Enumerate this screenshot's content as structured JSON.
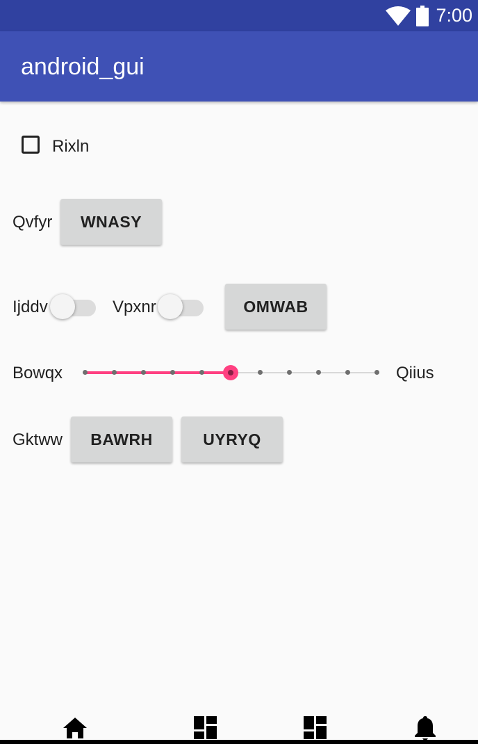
{
  "status_bar": {
    "time": "7:00",
    "wifi_icon": "wifi-icon",
    "battery_icon": "battery-icon"
  },
  "app_bar": {
    "title": "android_gui"
  },
  "checkbox": {
    "label": "Rixln",
    "checked": false
  },
  "row1": {
    "label": "Qvfyr",
    "button": "WNASY"
  },
  "row2": {
    "switch1": {
      "label": "Ijddv",
      "on": false
    },
    "switch2": {
      "label": "Vpxnr",
      "on": false
    },
    "button": "OMWAB"
  },
  "seekbar": {
    "label_left": "Bowqx",
    "label_right": "Qiius",
    "value": 5,
    "max": 10,
    "accent": "#ff4081"
  },
  "row4": {
    "label": "Gktww",
    "button1": "BAWRH",
    "button2": "UYRYQ"
  },
  "bottom_nav": [
    "home-icon",
    "dashboard-icon",
    "dashboard-icon",
    "notifications-icon"
  ],
  "colors": {
    "status_bar": "#3041a0",
    "app_bar": "#3f51b5",
    "background": "#fafafa"
  }
}
